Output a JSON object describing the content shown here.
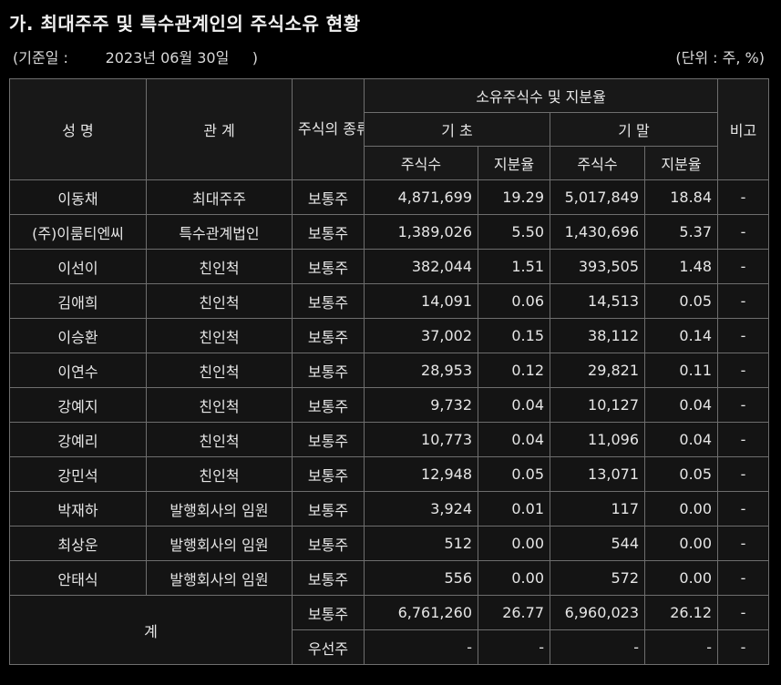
{
  "title": "가. 최대주주 및 특수관계인의 주식소유 현황",
  "base_date": "(기준일 :        2023년 06월 30일     )",
  "unit": "(단위 : 주, %)",
  "header": {
    "name": "성 명",
    "relation": "관 계",
    "stock_type": "주식의 종류",
    "owned": "소유주식수 및 지분율",
    "begin": "기 초",
    "end": "기 말",
    "shares": "주식수",
    "ratio": "지분율",
    "note": "비고"
  },
  "rows": [
    {
      "name": "이동채",
      "relation": "최대주주",
      "type": "보통주",
      "begin_shares": "4,871,699",
      "begin_ratio": "19.29",
      "end_shares": "5,017,849",
      "end_ratio": "18.84",
      "note": "-"
    },
    {
      "name": "(주)이룸티엔씨",
      "relation": "특수관계법인",
      "type": "보통주",
      "begin_shares": "1,389,026",
      "begin_ratio": "5.50",
      "end_shares": "1,430,696",
      "end_ratio": "5.37",
      "note": "-"
    },
    {
      "name": "이선이",
      "relation": "친인척",
      "type": "보통주",
      "begin_shares": "382,044",
      "begin_ratio": "1.51",
      "end_shares": "393,505",
      "end_ratio": "1.48",
      "note": "-"
    },
    {
      "name": "김애희",
      "relation": "친인척",
      "type": "보통주",
      "begin_shares": "14,091",
      "begin_ratio": "0.06",
      "end_shares": "14,513",
      "end_ratio": "0.05",
      "note": "-"
    },
    {
      "name": "이승환",
      "relation": "친인척",
      "type": "보통주",
      "begin_shares": "37,002",
      "begin_ratio": "0.15",
      "end_shares": "38,112",
      "end_ratio": "0.14",
      "note": "-"
    },
    {
      "name": "이연수",
      "relation": "친인척",
      "type": "보통주",
      "begin_shares": "28,953",
      "begin_ratio": "0.12",
      "end_shares": "29,821",
      "end_ratio": "0.11",
      "note": "-"
    },
    {
      "name": "강예지",
      "relation": "친인척",
      "type": "보통주",
      "begin_shares": "9,732",
      "begin_ratio": "0.04",
      "end_shares": "10,127",
      "end_ratio": "0.04",
      "note": "-"
    },
    {
      "name": "강예리",
      "relation": "친인척",
      "type": "보통주",
      "begin_shares": "10,773",
      "begin_ratio": "0.04",
      "end_shares": "11,096",
      "end_ratio": "0.04",
      "note": "-"
    },
    {
      "name": "강민석",
      "relation": "친인척",
      "type": "보통주",
      "begin_shares": "12,948",
      "begin_ratio": "0.05",
      "end_shares": "13,071",
      "end_ratio": "0.05",
      "note": "-"
    },
    {
      "name": "박재하",
      "relation": "발행회사의 임원",
      "type": "보통주",
      "begin_shares": "3,924",
      "begin_ratio": "0.01",
      "end_shares": "117",
      "end_ratio": "0.00",
      "note": "-"
    },
    {
      "name": "최상운",
      "relation": "발행회사의 임원",
      "type": "보통주",
      "begin_shares": "512",
      "begin_ratio": "0.00",
      "end_shares": "544",
      "end_ratio": "0.00",
      "note": "-"
    },
    {
      "name": "안태식",
      "relation": "발행회사의 임원",
      "type": "보통주",
      "begin_shares": "556",
      "begin_ratio": "0.00",
      "end_shares": "572",
      "end_ratio": "0.00",
      "note": "-"
    }
  ],
  "total": {
    "label": "계",
    "rows": [
      {
        "type": "보통주",
        "begin_shares": "6,761,260",
        "begin_ratio": "26.77",
        "end_shares": "6,960,023",
        "end_ratio": "26.12",
        "note": "-"
      },
      {
        "type": "우선주",
        "begin_shares": "-",
        "begin_ratio": "-",
        "end_shares": "-",
        "end_ratio": "-",
        "note": "-"
      }
    ]
  }
}
